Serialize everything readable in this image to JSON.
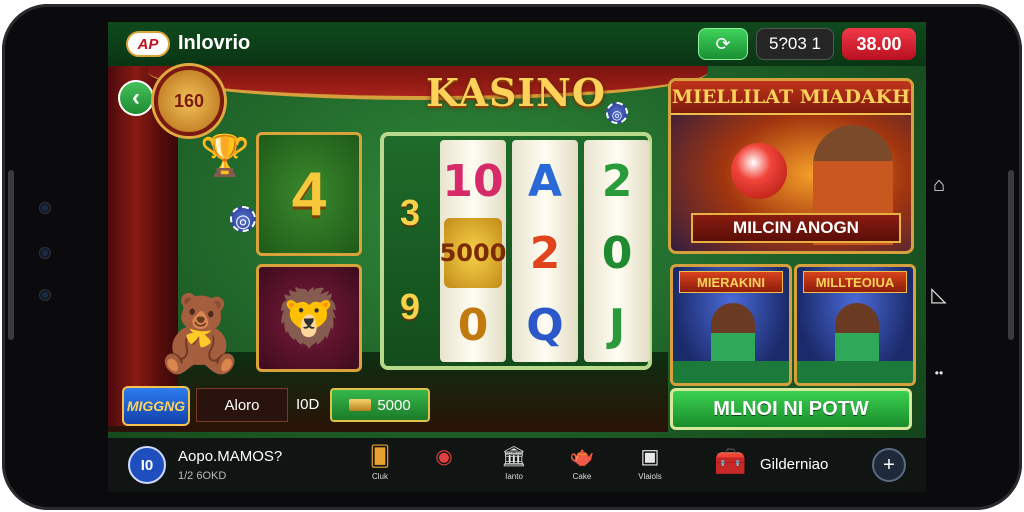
{
  "header": {
    "logo_text": "AP",
    "app_title": "Inlovrio",
    "coins": "5?03 1",
    "balance": "38.00"
  },
  "game": {
    "title": "KASINO",
    "wheel_label": "160",
    "tile_big_symbol": "4",
    "reel_side_numbers": [
      "3",
      "9"
    ],
    "reels": [
      [
        "10",
        "5000",
        "0"
      ],
      [
        "A",
        "2",
        "Q"
      ],
      [
        "2",
        "0",
        "J"
      ]
    ]
  },
  "promos": {
    "main_header": "MIELLILAT MIADAKH",
    "main_footer": "MILCIN ANOGN",
    "small": [
      {
        "header": "MIERAKINI"
      },
      {
        "header": "MILLTEOIUA"
      }
    ],
    "play_button": "MLNOI NI POTW"
  },
  "actions": {
    "fish_button": "MIGGNG",
    "field_value": "Aloro",
    "bet_label": "I0D",
    "bet_value": "5000"
  },
  "bottom": {
    "profile_badge": "I0",
    "profile_name": "Aopo.MAMOS?",
    "profile_sub": "1/2 6OKD",
    "nav": [
      {
        "label": "Cluk",
        "icon": "cards-icon"
      },
      {
        "label": "",
        "icon": "roulette-icon"
      },
      {
        "label": "Ianto",
        "icon": "bank-icon"
      },
      {
        "label": "Cake",
        "icon": "teapot-icon"
      },
      {
        "label": "Vlaiols",
        "icon": "gift-box-icon"
      }
    ],
    "rewards_label": "Gilderniao"
  },
  "colors": {
    "felt": "#2f8a3a",
    "gold": "#d6a13c",
    "accent_red": "#f2394a",
    "accent_green": "#3ad050"
  }
}
